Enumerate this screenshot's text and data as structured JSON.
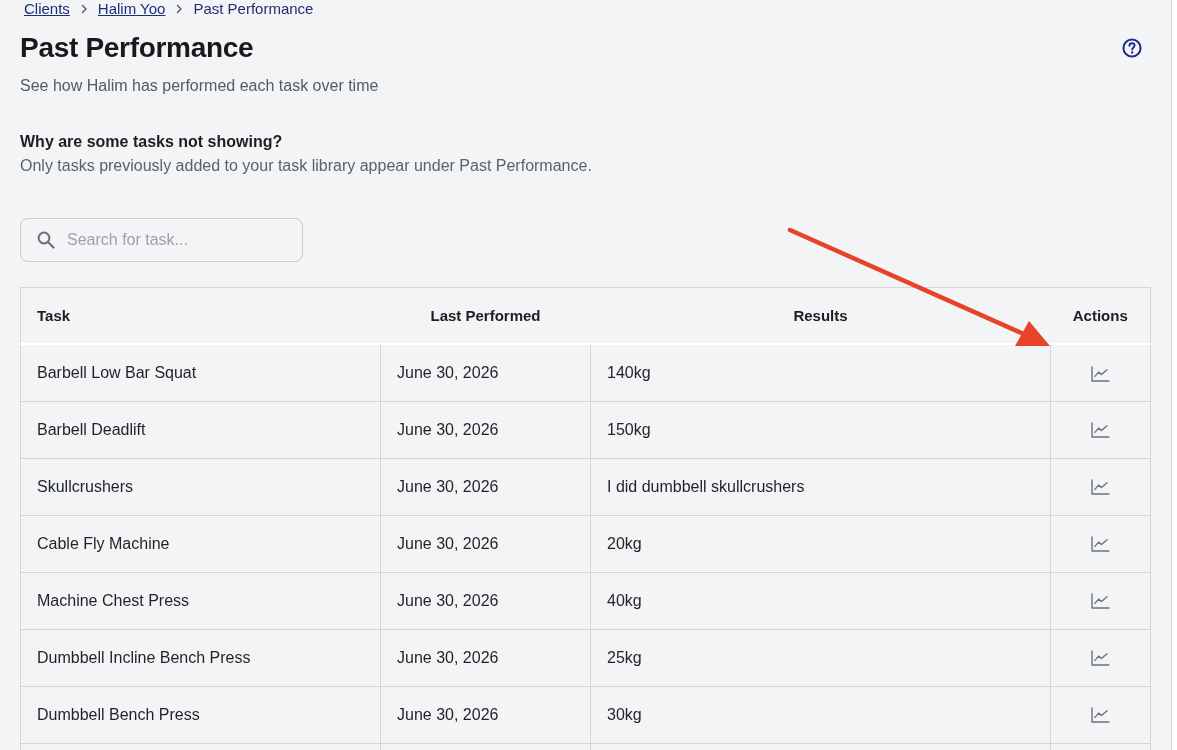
{
  "breadcrumb": [
    {
      "label": "Clients",
      "current": false
    },
    {
      "label": "Halim Yoo",
      "current": false
    },
    {
      "label": "Past Performance",
      "current": true
    }
  ],
  "page": {
    "title": "Past Performance",
    "subtitle": "See how Halim has performed each task over time"
  },
  "notice": {
    "heading": "Why are some tasks not showing?",
    "text": "Only tasks previously added to your task library appear under Past Performance."
  },
  "search": {
    "placeholder": "Search for task..."
  },
  "table": {
    "columns": [
      "Task",
      "Last Performed",
      "Results",
      "Actions"
    ],
    "rows": [
      {
        "task": "Barbell Low Bar Squat",
        "last_performed": "June 30, 2026",
        "results": "140kg"
      },
      {
        "task": "Barbell Deadlift",
        "last_performed": "June 30, 2026",
        "results": "150kg"
      },
      {
        "task": "Skullcrushers",
        "last_performed": "June 30, 2026",
        "results": "I did dumbbell skullcrushers"
      },
      {
        "task": "Cable Fly Machine",
        "last_performed": "June 30, 2026",
        "results": "20kg"
      },
      {
        "task": "Machine Chest Press",
        "last_performed": "June 30, 2026",
        "results": "40kg"
      },
      {
        "task": "Dumbbell Incline Bench Press",
        "last_performed": "June 30, 2026",
        "results": "25kg"
      },
      {
        "task": "Dumbbell Bench Press",
        "last_performed": "June 30, 2026",
        "results": "30kg"
      }
    ]
  }
}
